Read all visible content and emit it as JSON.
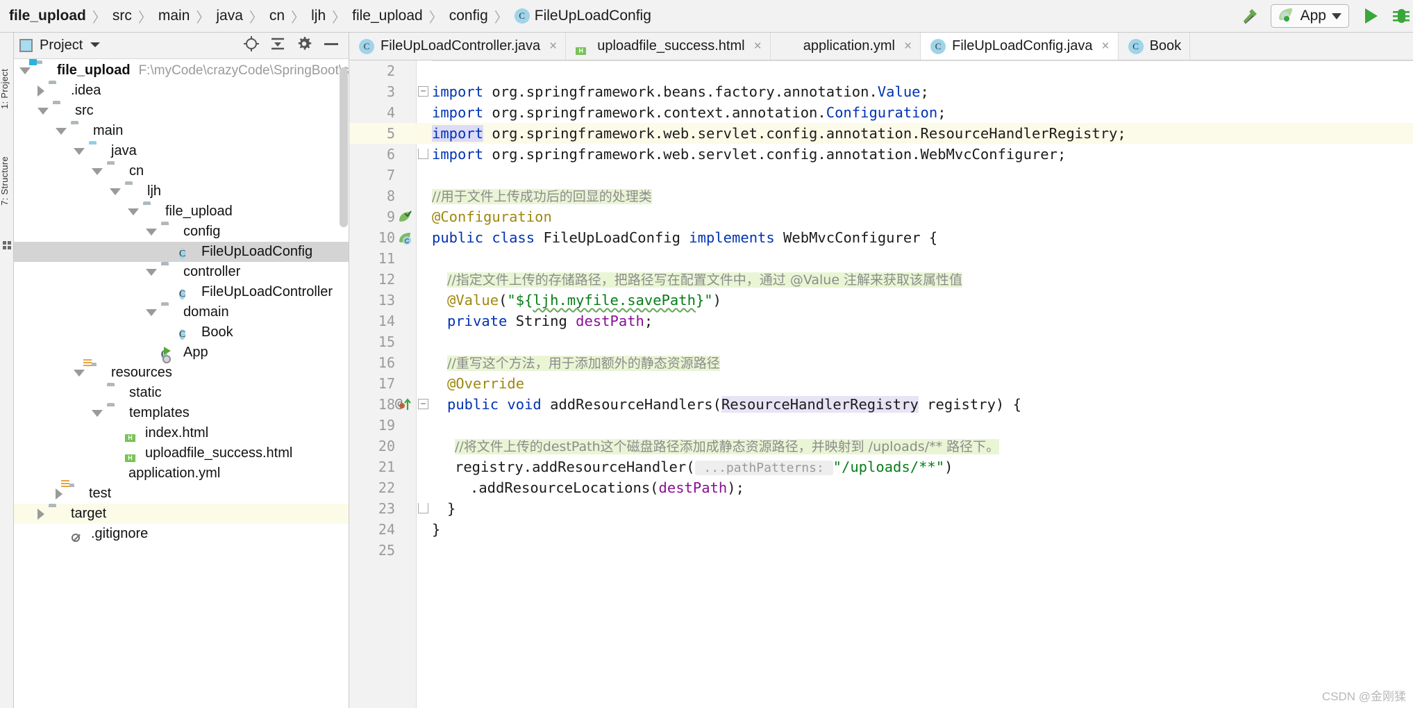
{
  "breadcrumb": {
    "items": [
      {
        "label": "file_upload",
        "bold": true,
        "icon": ""
      },
      {
        "label": "src",
        "bold": false,
        "icon": ""
      },
      {
        "label": "main",
        "bold": false,
        "icon": ""
      },
      {
        "label": "java",
        "bold": false,
        "icon": ""
      },
      {
        "label": "cn",
        "bold": false,
        "icon": ""
      },
      {
        "label": "ljh",
        "bold": false,
        "icon": ""
      },
      {
        "label": "file_upload",
        "bold": false,
        "icon": ""
      },
      {
        "label": "config",
        "bold": false,
        "icon": ""
      },
      {
        "label": "FileUpLoadConfig",
        "bold": false,
        "icon": "class-icon"
      }
    ],
    "separator": "〉"
  },
  "toolbar": {
    "build_icon": "hammer-icon",
    "run_config_label": "App",
    "run_config_icon": "spring-leaf-icon",
    "run_icon": "run-play-icon",
    "debug_icon": "debug-bug-icon",
    "dropdown_arrow": "chevron-down-icon"
  },
  "left_strip": {
    "tabs": [
      {
        "label": "1: Project",
        "name": "tool-window-project"
      },
      {
        "label": "7: Structure",
        "name": "tool-window-structure"
      }
    ]
  },
  "project_panel": {
    "title": "Project",
    "title_dropdown": "chevron-down-icon",
    "header_icons": [
      "locate-icon",
      "collapse-all-icon",
      "settings-gear-icon",
      "hide-minus-icon"
    ],
    "tree": [
      {
        "depth": 0,
        "twist": "open",
        "icon": "module-folder-icon",
        "name": "file_upload",
        "bold": true,
        "path": "F:\\myCode\\crazyCode\\SpringBoot\\sprin",
        "selected": false
      },
      {
        "depth": 1,
        "twist": "closed",
        "icon": "folder-icon",
        "name": ".idea",
        "bold": false,
        "path": "",
        "selected": false
      },
      {
        "depth": 1,
        "twist": "open",
        "icon": "folder-icon",
        "name": "src",
        "bold": false,
        "path": "",
        "selected": false
      },
      {
        "depth": 2,
        "twist": "open",
        "icon": "folder-icon",
        "name": "main",
        "bold": false,
        "path": "",
        "selected": false
      },
      {
        "depth": 3,
        "twist": "open",
        "icon": "source-folder-icon",
        "name": "java",
        "bold": false,
        "path": "",
        "selected": false
      },
      {
        "depth": 4,
        "twist": "open",
        "icon": "package-folder-icon",
        "name": "cn",
        "bold": false,
        "path": "",
        "selected": false
      },
      {
        "depth": 5,
        "twist": "open",
        "icon": "package-folder-icon",
        "name": "ljh",
        "bold": false,
        "path": "",
        "selected": false
      },
      {
        "depth": 6,
        "twist": "open",
        "icon": "package-folder-icon",
        "name": "file_upload",
        "bold": false,
        "path": "",
        "selected": false
      },
      {
        "depth": 7,
        "twist": "open",
        "icon": "package-folder-icon",
        "name": "config",
        "bold": false,
        "path": "",
        "selected": false
      },
      {
        "depth": 8,
        "twist": "none",
        "icon": "java-class-icon",
        "name": "FileUpLoadConfig",
        "bold": false,
        "path": "",
        "selected": true
      },
      {
        "depth": 7,
        "twist": "open",
        "icon": "package-folder-icon",
        "name": "controller",
        "bold": false,
        "path": "",
        "selected": false
      },
      {
        "depth": 8,
        "twist": "none",
        "icon": "java-class-icon",
        "name": "FileUpLoadController",
        "bold": false,
        "path": "",
        "selected": false
      },
      {
        "depth": 7,
        "twist": "open",
        "icon": "package-folder-icon",
        "name": "domain",
        "bold": false,
        "path": "",
        "selected": false
      },
      {
        "depth": 8,
        "twist": "none",
        "icon": "java-class-icon",
        "name": "Book",
        "bold": false,
        "path": "",
        "selected": false
      },
      {
        "depth": 7,
        "twist": "none",
        "icon": "java-runnable-class-icon",
        "name": "App",
        "bold": false,
        "path": "",
        "selected": false
      },
      {
        "depth": 3,
        "twist": "open",
        "icon": "resources-folder-icon",
        "name": "resources",
        "bold": false,
        "path": "",
        "selected": false
      },
      {
        "depth": 4,
        "twist": "none",
        "icon": "folder-icon",
        "name": "static",
        "bold": false,
        "path": "",
        "selected": false
      },
      {
        "depth": 4,
        "twist": "open",
        "icon": "folder-icon",
        "name": "templates",
        "bold": false,
        "path": "",
        "selected": false
      },
      {
        "depth": 5,
        "twist": "none",
        "icon": "html-file-icon",
        "name": "index.html",
        "bold": false,
        "path": "",
        "selected": false
      },
      {
        "depth": 5,
        "twist": "none",
        "icon": "html-file-icon",
        "name": "uploadfile_success.html",
        "bold": false,
        "path": "",
        "selected": false
      },
      {
        "depth": 4,
        "twist": "none",
        "icon": "yaml-spring-file-icon",
        "name": "application.yml",
        "bold": false,
        "path": "",
        "selected": false
      },
      {
        "depth": 2,
        "twist": "closed",
        "icon": "test-folder-icon",
        "name": "test",
        "bold": false,
        "path": "",
        "selected": false
      },
      {
        "depth": 1,
        "twist": "closed",
        "icon": "target-folder-icon",
        "name": "target",
        "bold": false,
        "path": "",
        "selected": false,
        "excluded": true
      },
      {
        "depth": 2,
        "twist": "none",
        "icon": "gitignore-file-icon",
        "name": ".gitignore",
        "bold": false,
        "path": "",
        "selected": false
      }
    ]
  },
  "editor": {
    "tabs": [
      {
        "label": "FileUpLoadController.java",
        "icon": "java-class-icon",
        "active": false,
        "close": "×"
      },
      {
        "label": "uploadfile_success.html",
        "icon": "html-file-icon",
        "active": false,
        "close": "×"
      },
      {
        "label": "application.yml",
        "icon": "yaml-spring-file-icon",
        "active": false,
        "close": "×"
      },
      {
        "label": "FileUpLoadConfig.java",
        "icon": "java-class-icon",
        "active": true,
        "close": "×"
      },
      {
        "label": "Book",
        "icon": "java-class-icon",
        "active": false,
        "close": ""
      }
    ],
    "current_line": 5,
    "watermark": "CSDN @金刚猱",
    "code_lines": [
      {
        "num": 2,
        "segments": []
      },
      {
        "num": 3,
        "fold": "minus",
        "segments": [
          {
            "t": "import",
            "c": "kw"
          },
          {
            "t": " org.springframework.beans.factory.annotation.",
            "c": ""
          },
          {
            "t": "Value",
            "c": "kw"
          },
          {
            "t": ";",
            "c": ""
          }
        ]
      },
      {
        "num": 4,
        "segments": [
          {
            "t": "import",
            "c": "kw"
          },
          {
            "t": " org.springframework.context.annotation.",
            "c": ""
          },
          {
            "t": "Configuration",
            "c": "kw"
          },
          {
            "t": ";",
            "c": ""
          }
        ]
      },
      {
        "num": 5,
        "current": true,
        "caret": true,
        "segments": [
          {
            "t": "import",
            "c": "kw selword"
          },
          {
            "t": " org.springframework.web.servlet.config.annotation.ResourceHandlerRegistry;",
            "c": ""
          }
        ]
      },
      {
        "num": 6,
        "fold": "end",
        "segments": [
          {
            "t": "import",
            "c": "kw"
          },
          {
            "t": " org.springframework.web.servlet.config.annotation.WebMvcConfigurer;",
            "c": ""
          }
        ]
      },
      {
        "num": 7,
        "segments": []
      },
      {
        "num": 8,
        "segments": [
          {
            "t": "//用于文件上传成功后的回显的处理类",
            "c": "cmt"
          }
        ]
      },
      {
        "num": 9,
        "gutter_icon": "spring-bean-icon",
        "segments": [
          {
            "t": "@Configuration",
            "c": "ann"
          }
        ]
      },
      {
        "num": 10,
        "gutter_icon": "spring-config-icon",
        "segments": [
          {
            "t": "public",
            "c": "kw"
          },
          {
            "t": " ",
            "c": ""
          },
          {
            "t": "class",
            "c": "kw"
          },
          {
            "t": " FileUpLoadConfig ",
            "c": ""
          },
          {
            "t": "implements",
            "c": "kw"
          },
          {
            "t": " WebMvcConfigurer {",
            "c": ""
          }
        ]
      },
      {
        "num": 11,
        "segments": []
      },
      {
        "num": 12,
        "indent": 2,
        "segments": [
          {
            "t": "//指定文件上传的存储路径，把路径写在配置文件中，通过 @Value 注解来获取该属性值",
            "c": "cmt"
          }
        ]
      },
      {
        "num": 13,
        "indent": 2,
        "segments": [
          {
            "t": "@Value",
            "c": "ann"
          },
          {
            "t": "(",
            "c": ""
          },
          {
            "t": "\"${",
            "c": "str"
          },
          {
            "t": "ljh.myfile.savePath",
            "c": "str wavy"
          },
          {
            "t": "}\"",
            "c": "str"
          },
          {
            "t": ")",
            "c": ""
          }
        ]
      },
      {
        "num": 14,
        "indent": 2,
        "segments": [
          {
            "t": "private",
            "c": "kw"
          },
          {
            "t": " String ",
            "c": ""
          },
          {
            "t": "destPath",
            "c": "fld"
          },
          {
            "t": ";",
            "c": ""
          }
        ]
      },
      {
        "num": 15,
        "segments": []
      },
      {
        "num": 16,
        "indent": 2,
        "segments": [
          {
            "t": "//重写这个方法，用于添加额外的静态资源路径",
            "c": "cmt"
          }
        ]
      },
      {
        "num": 17,
        "indent": 2,
        "segments": [
          {
            "t": "@Override",
            "c": "ann"
          }
        ]
      },
      {
        "num": 18,
        "indent": 2,
        "gutter_icon": "override-method-icon",
        "gutter_icon2": "at-icon",
        "fold": "minus",
        "segments": [
          {
            "t": "public",
            "c": "kw"
          },
          {
            "t": " ",
            "c": ""
          },
          {
            "t": "void",
            "c": "kw"
          },
          {
            "t": " addResourceHandlers",
            "c": ""
          },
          {
            "t": "(",
            "c": ""
          },
          {
            "t": "ResourceHandlerRegistry",
            "c": "idhl"
          },
          {
            "t": " registry) {",
            "c": ""
          }
        ]
      },
      {
        "num": 19,
        "segments": []
      },
      {
        "num": 20,
        "indent": 3,
        "segments": [
          {
            "t": "//将文件上传的destPath这个磁盘路径添加成静态资源路径，并映射到 /uploads/** 路径下。",
            "c": "cmt"
          }
        ]
      },
      {
        "num": 21,
        "indent": 3,
        "segments": [
          {
            "t": "registry.addResourceHandler(",
            "c": ""
          },
          {
            "t": " ...pathPatterns: ",
            "c": "hint"
          },
          {
            "t": "\"/uploads/**\"",
            "c": "str"
          },
          {
            "t": ")",
            "c": ""
          }
        ]
      },
      {
        "num": 22,
        "indent": 5,
        "segments": [
          {
            "t": ".addResourceLocations(",
            "c": ""
          },
          {
            "t": "destPath",
            "c": "fld"
          },
          {
            "t": ");",
            "c": ""
          }
        ]
      },
      {
        "num": 23,
        "indent": 2,
        "fold": "end",
        "segments": [
          {
            "t": "}",
            "c": ""
          }
        ]
      },
      {
        "num": 24,
        "segments": [
          {
            "t": "}",
            "c": ""
          }
        ]
      },
      {
        "num": 25,
        "segments": []
      }
    ]
  }
}
